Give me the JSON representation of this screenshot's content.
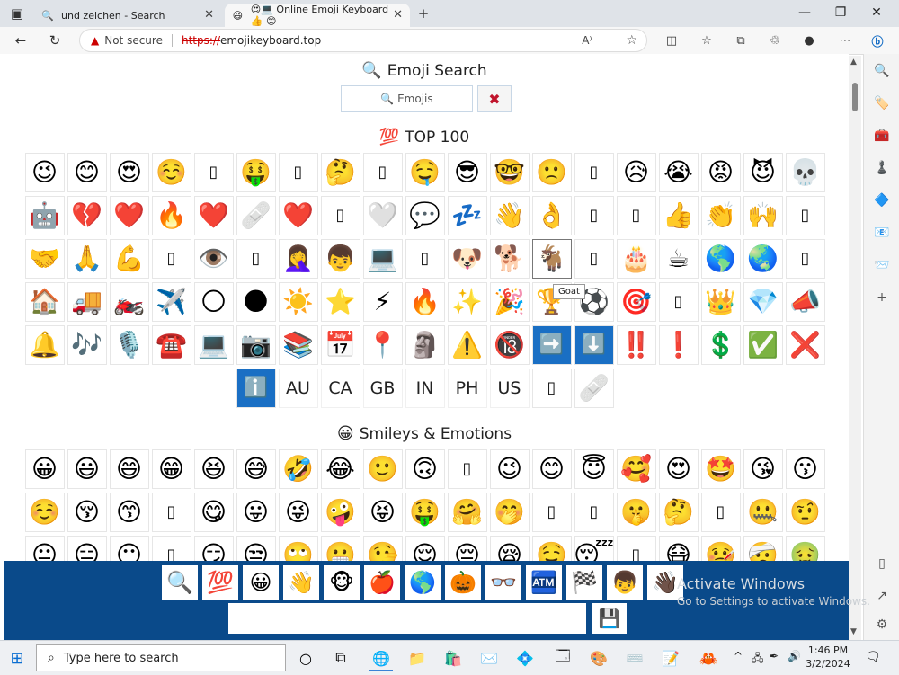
{
  "browser": {
    "tabs": [
      {
        "title": "und zeichen - Search",
        "icon": "🔍"
      },
      {
        "title": "😍💻 Online Emoji Keyboard 👍 😊",
        "icon": "😃"
      }
    ],
    "new_tab": "+",
    "window": {
      "minimize": "—",
      "restore": "❐",
      "close": "✕"
    },
    "address": {
      "warning": "▲",
      "not_secure": "Not secure",
      "scheme": "https://",
      "host": "emojikeyboard.top"
    }
  },
  "page": {
    "search_heading": "Emoji Search",
    "search_heading_icon": "🔍",
    "search_placeholder": "🔍 Emojis",
    "clear_button": "✖",
    "top100_heading": "TOP 100",
    "top100_icon": "💯",
    "tooltip": "Goat",
    "top100_rows": [
      [
        "😉",
        "😊",
        "😍",
        "☺️",
        "▯",
        "🤑",
        "▯",
        "🤔",
        "▯",
        "🤤",
        "😎",
        "🤓",
        "🙁",
        "▯",
        "😥",
        "😭",
        "😡",
        "😈",
        "💀"
      ],
      [
        "🤖",
        "💔",
        "❤️",
        "🔥",
        "❤️",
        "🩹",
        "❤️",
        "▯",
        "🤍",
        "💬",
        "💤",
        "👋",
        "👌",
        "▯",
        "▯",
        "👍",
        "👏",
        "🙌",
        "▯"
      ],
      [
        "🤝",
        "🙏",
        "💪",
        "▯",
        "👁️",
        "▯",
        "🤦‍♀️",
        "👦",
        "💻",
        "▯",
        "🐶",
        "🐕",
        "🐐",
        "▯",
        "🎂",
        "☕",
        "🌎",
        "🌏",
        "▯"
      ],
      [
        "🏠",
        "🚚",
        "🏍️",
        "✈️",
        "🌕",
        "🌑",
        "☀️",
        "⭐",
        "⚡",
        "🔥",
        "✨",
        "🎉",
        "🏆",
        "⚽",
        "🎯",
        "▯",
        "👑",
        "💎",
        "📣"
      ],
      [
        "🔔",
        "🎶",
        "🎙️",
        "☎️",
        "💻",
        "📷",
        "📚",
        "📅",
        "📍",
        "🗿",
        "⚠️",
        "🔞",
        "➡️",
        "⬇️",
        "‼️",
        "❗",
        "💲",
        "✅",
        "❌"
      ]
    ],
    "flags_row": [
      "ℹ️",
      "AU",
      "CA",
      "GB",
      "IN",
      "PH",
      "US",
      "▯",
      "🩹"
    ],
    "smileys_heading": "Smileys & Emotions",
    "smileys_icon": "😀",
    "smiley_rows": [
      [
        "😀",
        "😃",
        "😄",
        "😁",
        "😆",
        "😅",
        "🤣",
        "😂",
        "🙂",
        "🙃",
        "▯",
        "😉",
        "😊",
        "😇",
        "🥰",
        "😍",
        "🤩",
        "😘",
        "😗"
      ],
      [
        "☺️",
        "😚",
        "😙",
        "▯",
        "😋",
        "😛",
        "😜",
        "🤪",
        "😝",
        "🤑",
        "🤗",
        "🤭",
        "▯",
        "▯",
        "🤫",
        "🤔",
        "▯",
        "🤐",
        "🤨"
      ],
      [
        "😐",
        "😑",
        "😶",
        "▯",
        "😏",
        "😒",
        "🙄",
        "😬",
        "🤥",
        "😌",
        "😔",
        "😪",
        "🤤",
        "😴",
        "▯",
        "😷",
        "🤒",
        "🤕",
        "🤢"
      ]
    ],
    "bottom_bar": [
      "🔍",
      "💯",
      "😀",
      "👋",
      "🐵",
      "🍎",
      "🌎",
      "🎃",
      "👓",
      "🏧",
      "🏁",
      "👦",
      "👋🏿"
    ],
    "save_icon": "💾"
  },
  "watermark": {
    "title": "Activate Windows",
    "subtitle": "Go to Settings to activate Windows."
  },
  "taskbar": {
    "search_placeholder": "Type here to search",
    "time": "1:46 PM",
    "date": "3/2/2024"
  },
  "colors": {
    "accent": "#0a4a8a",
    "warning": "#cc0000"
  }
}
